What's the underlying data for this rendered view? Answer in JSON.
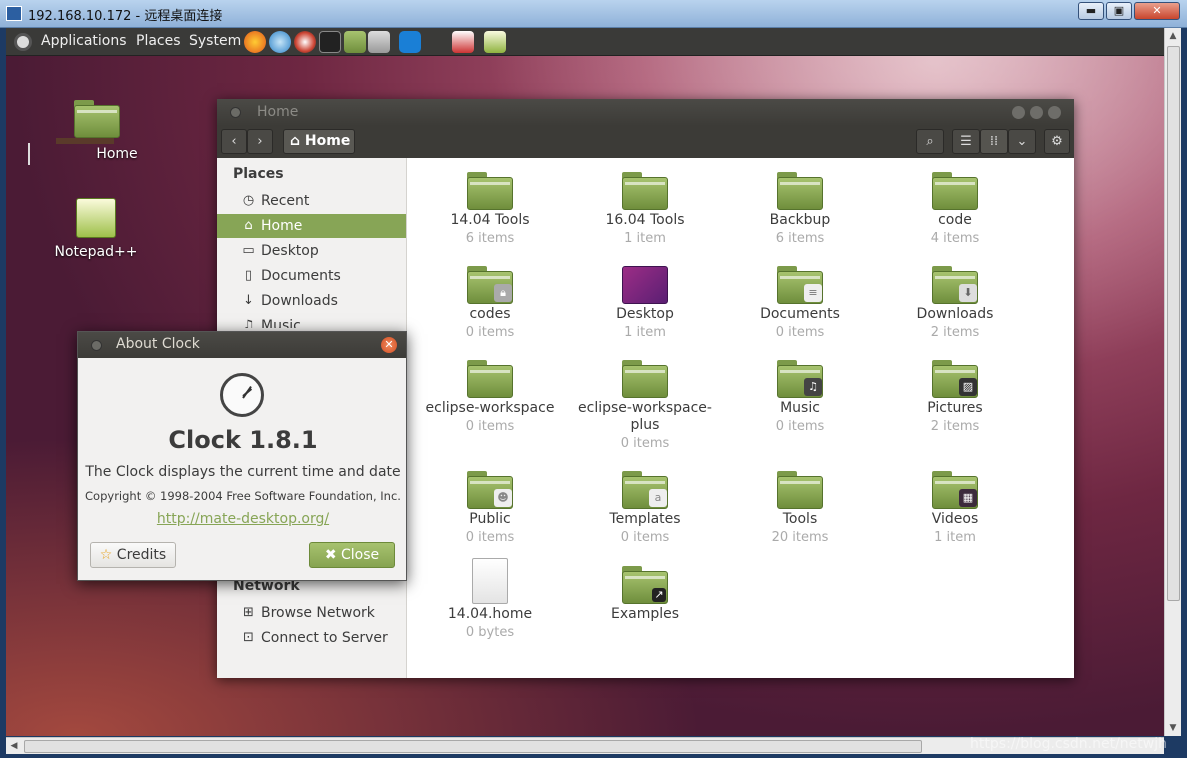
{
  "rdp": {
    "title": "192.168.10.172 - 远程桌面连接",
    "min": "▬",
    "max": "▣",
    "close": "✕"
  },
  "panel": {
    "menus": [
      "Applications",
      "Places",
      "System"
    ]
  },
  "desktop_icons": [
    {
      "label": "Home",
      "icon": "home-folder-icon"
    },
    {
      "label": "Notepad++",
      "icon": "notepad-plus-plus-icon"
    }
  ],
  "file_manager": {
    "title": "Home",
    "breadcrumb": "Home",
    "sidebar": {
      "places_header": "Places",
      "items": [
        {
          "label": "Recent",
          "icon": "clock-icon"
        },
        {
          "label": "Home",
          "icon": "home-icon"
        },
        {
          "label": "Desktop",
          "icon": "desktop-icon"
        },
        {
          "label": "Documents",
          "icon": "document-icon"
        },
        {
          "label": "Downloads",
          "icon": "download-icon"
        },
        {
          "label": "Music",
          "icon": "music-icon"
        }
      ],
      "network_header": "Network",
      "network_items": [
        {
          "label": "Browse Network",
          "icon": "network-icon"
        },
        {
          "label": "Connect to Server",
          "icon": "server-icon"
        }
      ]
    },
    "items": [
      {
        "name": "14.04 Tools",
        "sub": "6 items"
      },
      {
        "name": "16.04 Tools",
        "sub": "1 item"
      },
      {
        "name": "Backbup",
        "sub": "6 items"
      },
      {
        "name": "code",
        "sub": "4 items"
      },
      {
        "name": "codes",
        "sub": "0 items"
      },
      {
        "name": "Desktop",
        "sub": "1 item"
      },
      {
        "name": "Documents",
        "sub": "0 items"
      },
      {
        "name": "Downloads",
        "sub": "2 items"
      },
      {
        "name": "eclipse-workspace",
        "sub": "0 items"
      },
      {
        "name": "eclipse-workspace-plus",
        "sub": "0 items"
      },
      {
        "name": "Music",
        "sub": "0 items"
      },
      {
        "name": "Pictures",
        "sub": "2 items"
      },
      {
        "name": "Public",
        "sub": "0 items"
      },
      {
        "name": "Templates",
        "sub": "0 items"
      },
      {
        "name": "Tools",
        "sub": "20 items"
      },
      {
        "name": "Videos",
        "sub": "1 item"
      },
      {
        "name": "14.04.home",
        "sub": "0 bytes"
      },
      {
        "name": "Examples",
        "sub": ""
      }
    ]
  },
  "about": {
    "title": "About Clock",
    "app_name": "Clock 1.8.1",
    "description": "The Clock displays the current time and date",
    "copyright": "Copyright © 1998-2004 Free Software Foundation, Inc.",
    "link": "http://mate-desktop.org/",
    "credits_label": "Credits",
    "close_label": "Close"
  },
  "watermark": "https://blog.csdn.net/netwjh",
  "colors": {
    "accent": "#87a556",
    "panel": "#3a3a38",
    "close_orange": "#d34e24"
  }
}
